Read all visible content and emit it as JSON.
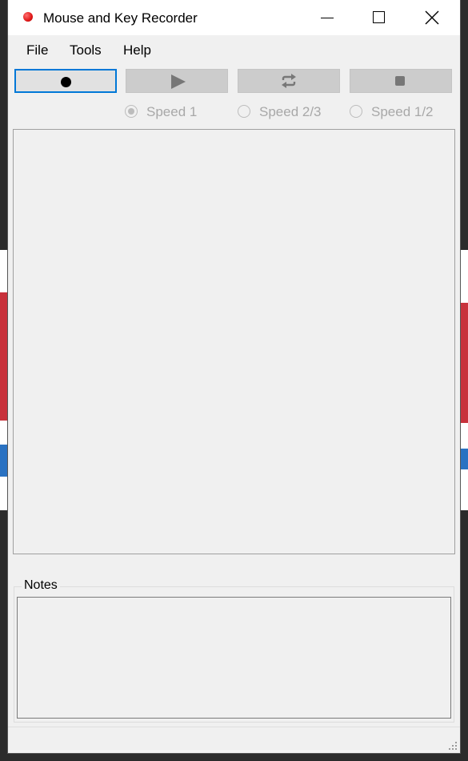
{
  "window": {
    "title": "Mouse and Key Recorder",
    "app_icon": "red-record-dot-icon",
    "controls": [
      "minimize-icon",
      "maximize-icon",
      "close-icon"
    ]
  },
  "menu": {
    "items": [
      {
        "label": "File"
      },
      {
        "label": "Tools"
      },
      {
        "label": "Help"
      }
    ]
  },
  "toolbar": {
    "buttons": [
      {
        "name": "record",
        "icon": "record-dot-icon",
        "enabled": true,
        "focused": true
      },
      {
        "name": "play",
        "icon": "play-icon",
        "enabled": false
      },
      {
        "name": "loop",
        "icon": "repeat-icon",
        "enabled": false
      },
      {
        "name": "stop",
        "icon": "stop-icon",
        "enabled": false
      }
    ]
  },
  "speed": {
    "enabled": false,
    "selected": "Speed 1",
    "options": [
      {
        "label": "Speed 1",
        "checked": true
      },
      {
        "label": "Speed 2/3",
        "checked": false
      },
      {
        "label": "Speed 1/2",
        "checked": false
      }
    ]
  },
  "notes": {
    "label": "Notes",
    "value": ""
  },
  "colors": {
    "window_bg": "#f0f0f0",
    "titlebar_bg": "#ffffff",
    "focus_border": "#0078d7",
    "disabled_text": "#a8a8a8",
    "record_icon": "#e01818"
  }
}
